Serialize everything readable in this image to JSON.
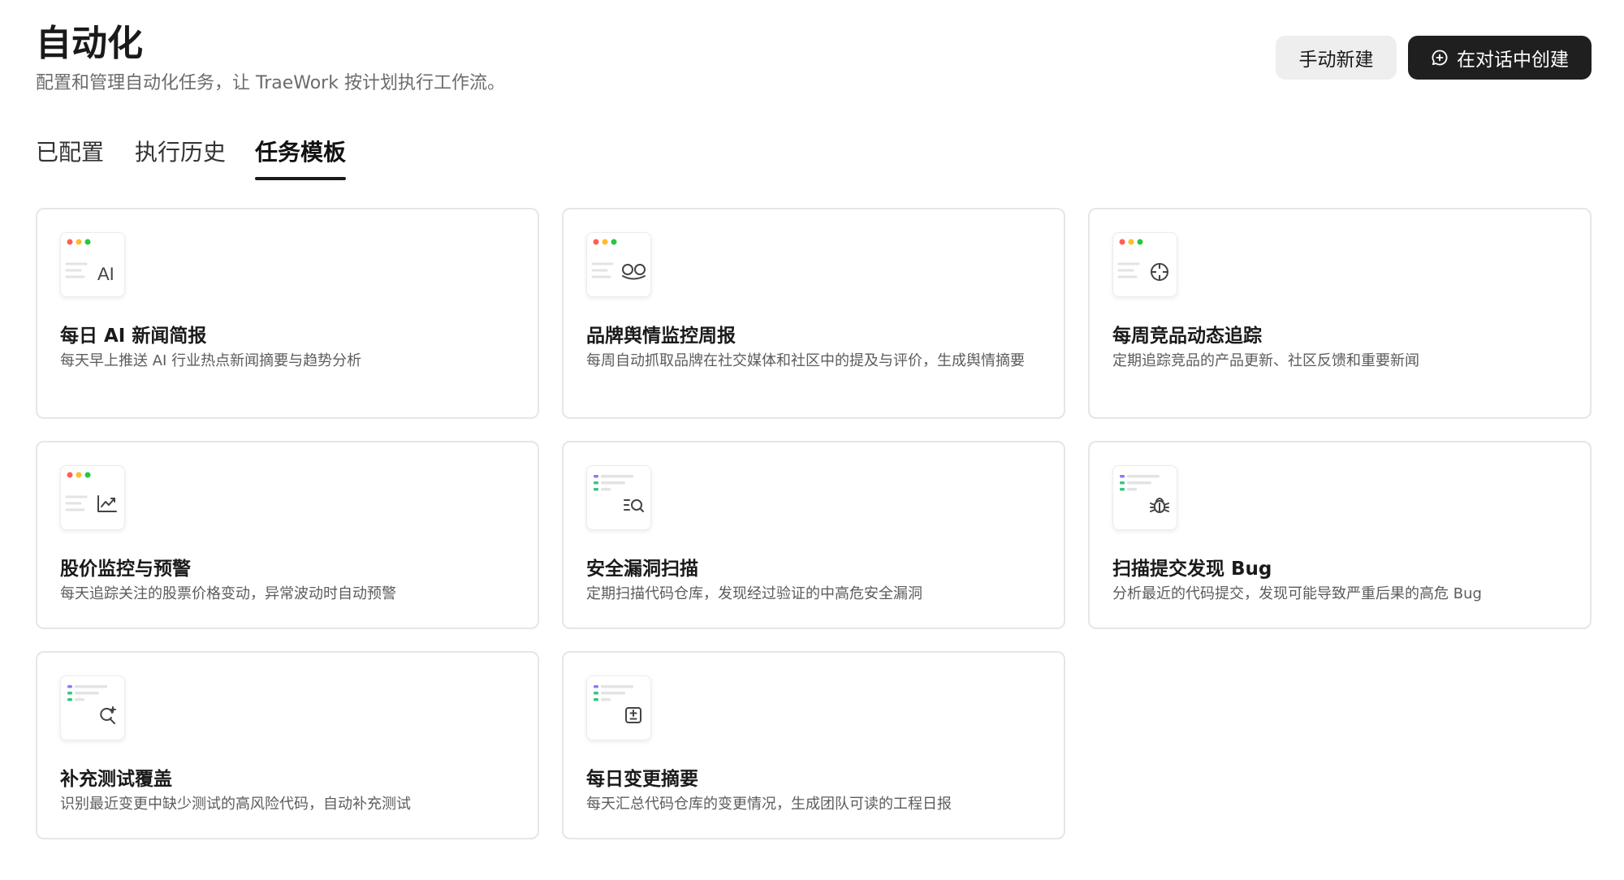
{
  "header": {
    "title": "自动化",
    "subtitle": "配置和管理自动化任务，让 TraeWork 按计划执行工作流。",
    "manual_button": "手动新建",
    "chat_button": "在对话中创建"
  },
  "tabs": [
    {
      "label": "已配置",
      "active": false
    },
    {
      "label": "执行历史",
      "active": false
    },
    {
      "label": "任务模板",
      "active": true
    }
  ],
  "templates": [
    {
      "title": "每日 AI 新闻简报",
      "desc": "每天早上推送 AI 行业热点新闻摘要与趋势分析",
      "icon": "ai-text-icon",
      "thumb": "window"
    },
    {
      "title": "品牌舆情监控周报",
      "desc": "每周自动抓取品牌在社交媒体和社区中的提及与评价，生成舆情摘要",
      "icon": "glasses-icon",
      "thumb": "window"
    },
    {
      "title": "每周竞品动态追踪",
      "desc": "定期追踪竞品的产品更新、社区反馈和重要新闻",
      "icon": "crosshair-icon",
      "thumb": "window"
    },
    {
      "title": "股价监控与预警",
      "desc": "每天追踪关注的股票价格变动，异常波动时自动预警",
      "icon": "trend-chart-icon",
      "thumb": "window"
    },
    {
      "title": "安全漏洞扫描",
      "desc": "定期扫描代码仓库，发现经过验证的中高危安全漏洞",
      "icon": "list-search-icon",
      "thumb": "code"
    },
    {
      "title": "扫描提交发现 Bug",
      "desc": "分析最近的代码提交，发现可能导致严重后果的高危 Bug",
      "icon": "bug-icon",
      "thumb": "code"
    },
    {
      "title": "补充测试覆盖",
      "desc": "识别最近变更中缺少测试的高风险代码，自动补充测试",
      "icon": "search-sparkle-icon",
      "thumb": "code"
    },
    {
      "title": "每日变更摘要",
      "desc": "每天汇总代码仓库的变更情况，生成团队可读的工程日报",
      "icon": "diff-icon",
      "thumb": "code"
    }
  ],
  "colors": {
    "dot_red": "#ff5f57",
    "dot_yellow": "#febc2e",
    "dot_green": "#28c840",
    "code_purple": "#8b7cf6",
    "code_green": "#34c77b"
  }
}
